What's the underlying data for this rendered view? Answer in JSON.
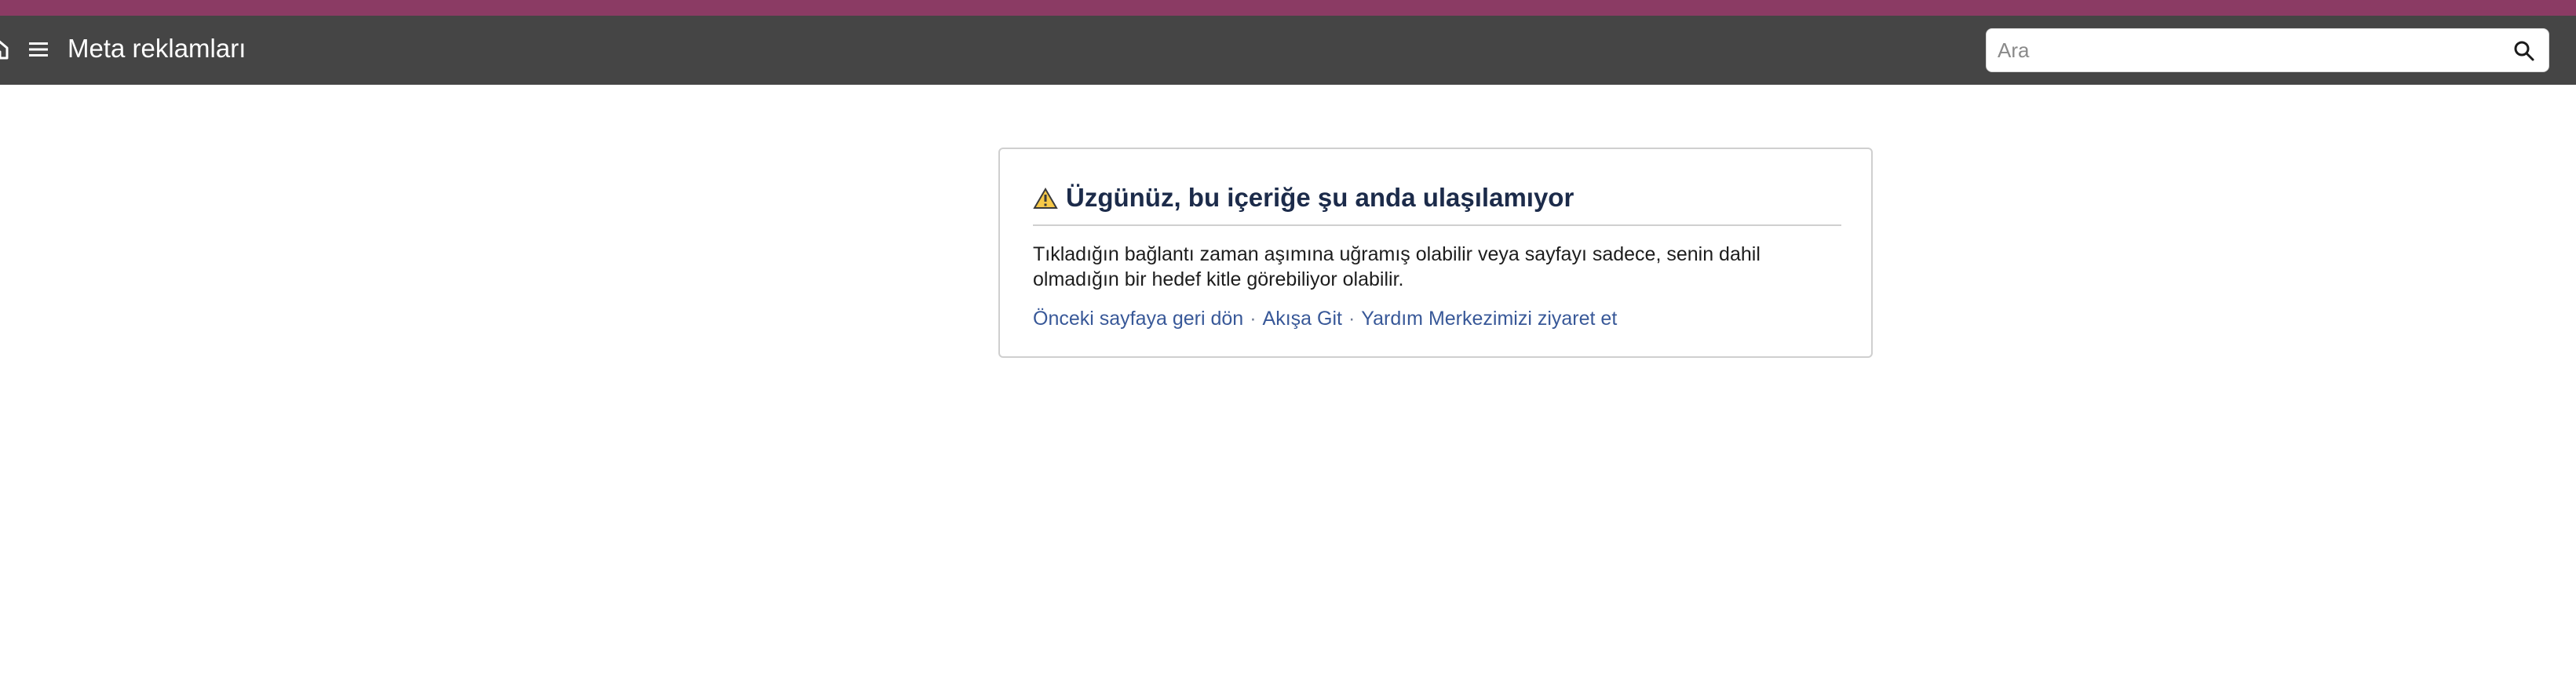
{
  "header": {
    "title": "Meta reklamları",
    "search_placeholder": "Ara"
  },
  "icons": {
    "home": "home-icon",
    "menu": "menu-icon",
    "search": "search-icon",
    "warning": "warning-icon"
  },
  "panel": {
    "title": "Üzgünüz, bu içeriğe şu anda ulaşılamıyor",
    "message": "Tıkladığın bağlantı zaman aşımına uğramış olabilir veya sayfayı sadece, senin dahil olmadığın bir hedef kitle görebiliyor olabilir.",
    "links": [
      "Önceki sayfaya geri dön",
      "Akışa Git",
      "Yardım Merkezimizi ziyaret et"
    ],
    "separator": "·"
  },
  "colors": {
    "top_strip": "#8b3b64",
    "header_bg": "#454545",
    "link": "#385898",
    "title": "#1c2b4a"
  }
}
